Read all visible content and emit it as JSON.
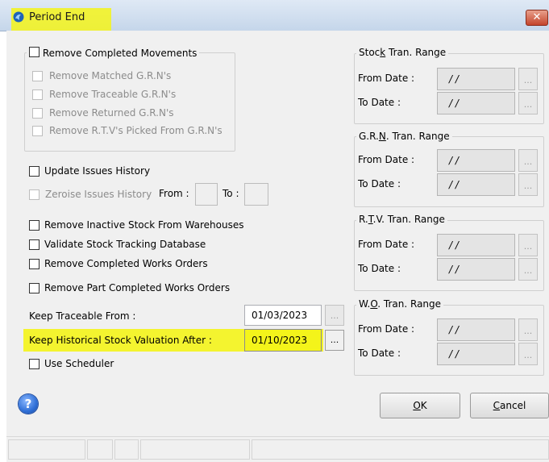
{
  "window": {
    "title": "Period End",
    "close_label": "✕"
  },
  "left": {
    "remove_completed_movements": "Remove Completed Movements",
    "sub_options": [
      "Remove Matched G.R.N's",
      "Remove Traceable G.R.N's",
      "Remove Returned G.R.N's",
      "Remove R.T.V's Picked From G.R.N's"
    ],
    "update_issues_history": "Update Issues History",
    "zeroise_issues_history": "Zeroise Issues History",
    "zeroise_from_label": "From :",
    "zeroise_to_label": "To :",
    "remove_inactive_stock": "Remove Inactive Stock From Warehouses",
    "validate_stock_tracking": "Validate Stock Tracking Database",
    "remove_completed_works_orders": "Remove Completed Works Orders",
    "remove_part_completed_works_orders": "Remove Part Completed Works Orders",
    "keep_traceable_label": "Keep Traceable From :",
    "keep_traceable_value": "01/03/2023",
    "keep_historical_label": "Keep Historical Stock Valuation After :",
    "keep_historical_value": "01/10/2023",
    "use_scheduler": "Use Scheduler",
    "ellipsis": "..."
  },
  "ranges": [
    {
      "title_pre": "Stoc",
      "title_u": "k",
      "title_post": " Tran. Range",
      "from_label": "From Date :",
      "from_value": "/ /",
      "to_label": "To Date :",
      "to_value": "/ /"
    },
    {
      "title_pre": "G.R.",
      "title_u": "N",
      "title_post": ". Tran. Range",
      "from_label": "From Date :",
      "from_value": "/ /",
      "to_label": "To Date :",
      "to_value": "/ /"
    },
    {
      "title_pre": "R.",
      "title_u": "T",
      "title_post": ".V. Tran. Range",
      "from_label": "From Date :",
      "from_value": "/ /",
      "to_label": "To Date :",
      "to_value": "/ /"
    },
    {
      "title_pre": "W.",
      "title_u": "O",
      "title_post": ". Tran. Range",
      "from_label": "From Date :",
      "from_value": "/ /",
      "to_label": "To Date :",
      "to_value": "/ /"
    }
  ],
  "buttons": {
    "ok_u": "O",
    "ok_rest": "K",
    "cancel_u": "C",
    "cancel_rest": "ancel"
  },
  "help_icon_label": "?",
  "colors": {
    "highlight": "#f4f41a",
    "help_blue": "#2f6fd6"
  }
}
